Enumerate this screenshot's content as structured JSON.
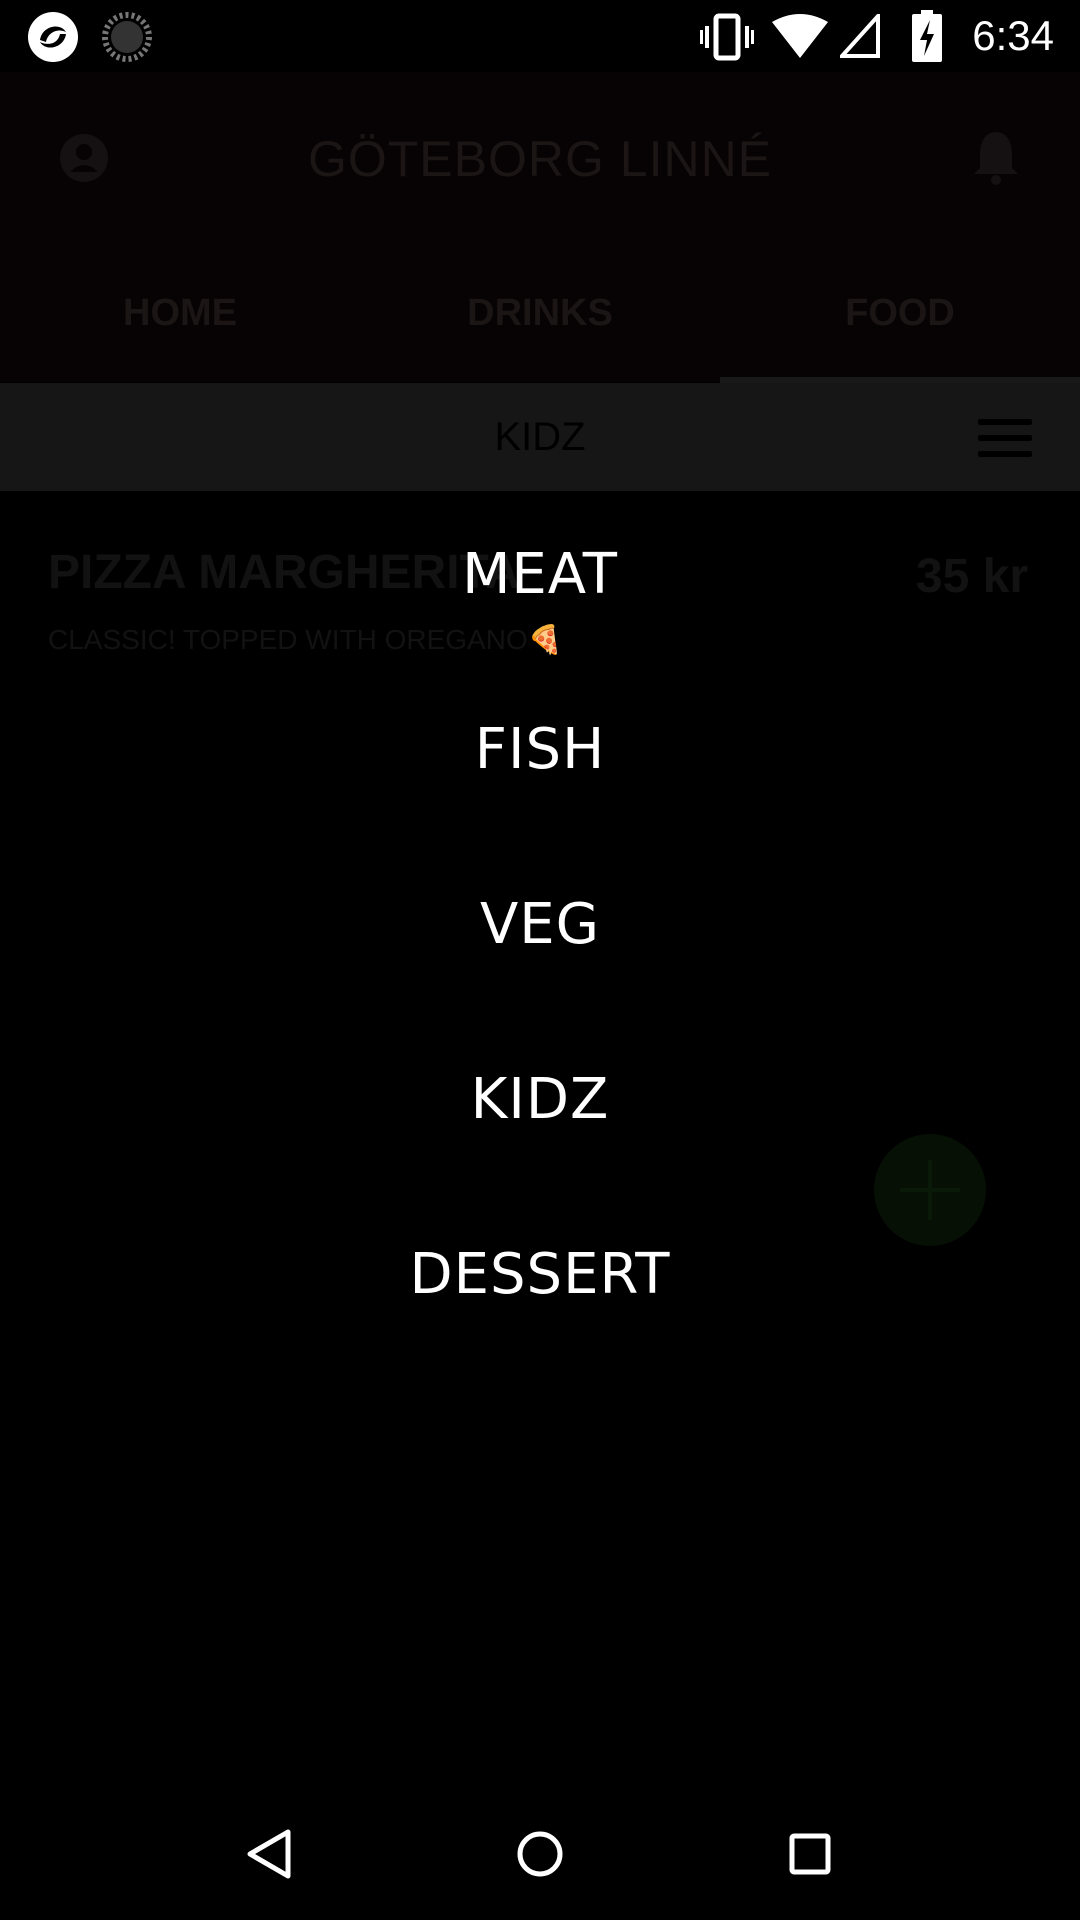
{
  "status_bar": {
    "time": "6:34",
    "icons": [
      "app-logo-icon",
      "loading-icon",
      "vibrate-icon",
      "wifi-icon",
      "signal-icon",
      "battery-charging-icon"
    ]
  },
  "app_bar": {
    "title": "GÖTEBORG LINNÉ",
    "icons": [
      "account-icon",
      "bell-icon"
    ]
  },
  "tabs": [
    {
      "label": "HOME"
    },
    {
      "label": "DRINKS"
    },
    {
      "label": "FOOD"
    }
  ],
  "sub_bar": {
    "title": "KIDZ",
    "icon": "menu-icon"
  },
  "menu_item": {
    "name": "PIZZA MARGHERITA",
    "price": "35 kr",
    "description": "CLASSIC! TOPPED WITH OREGANO🍕"
  },
  "overlay_menu": {
    "items": [
      {
        "label": "MEAT"
      },
      {
        "label": "FISH"
      },
      {
        "label": "VEG"
      },
      {
        "label": "KIDZ"
      },
      {
        "label": "DESSERT"
      }
    ]
  },
  "fab": {
    "icon": "add-icon"
  },
  "nav_bar": {
    "icons": [
      "back-icon",
      "home-icon",
      "recents-icon"
    ]
  }
}
